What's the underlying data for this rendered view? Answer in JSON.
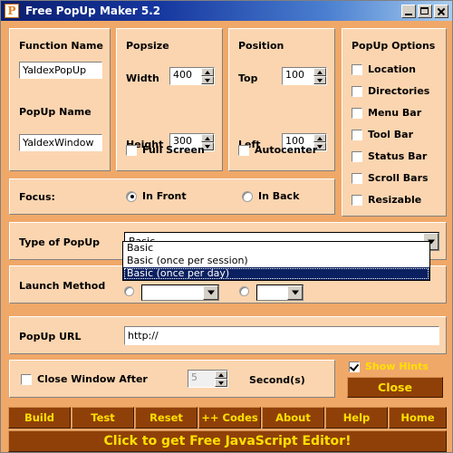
{
  "window": {
    "title": "Free PopUp Maker 5.2",
    "icon": "P",
    "minimize": "minimize-icon",
    "maximize": "maximize-icon",
    "close": "close-icon"
  },
  "function_panel": {
    "function_name_label": "Function Name",
    "function_name_value": "YaldexPopUp",
    "popup_name_label": "PopUp Name",
    "popup_name_value": "YaldexWindow"
  },
  "popsize_panel": {
    "title": "Popsize",
    "width_label": "Width",
    "width_value": "400",
    "height_label": "Height",
    "height_value": "300",
    "fullscreen_label": "Full Screen",
    "fullscreen_checked": false
  },
  "position_panel": {
    "title": "Position",
    "top_label": "Top",
    "top_value": "100",
    "left_label": "Left",
    "left_value": "100",
    "autocenter_label": "Autocenter",
    "autocenter_checked": false
  },
  "options_panel": {
    "title": "PopUp Options",
    "items": [
      {
        "label": "Location",
        "accel": "L",
        "checked": false
      },
      {
        "label": "Directories",
        "accel": "i",
        "checked": false
      },
      {
        "label": "Menu Bar",
        "accel": "M",
        "checked": false
      },
      {
        "label": "Tool Bar",
        "accel": "l",
        "checked": false
      },
      {
        "label": "Status Bar",
        "accel": "B",
        "checked": false
      },
      {
        "label": "Scroll Bars",
        "accel": "c",
        "checked": false
      },
      {
        "label": "Resizable",
        "accel": "R",
        "checked": false
      }
    ]
  },
  "focus_panel": {
    "label": "Focus:",
    "in_front_label": "In Front",
    "in_back_label": "In Back",
    "selected": "In Front"
  },
  "type_panel": {
    "label": "Type of PopUp",
    "selected_value": "Basic",
    "options": [
      "Basic",
      "Basic (once per session)",
      "Basic (once per day)"
    ],
    "highlighted_option": "Basic (once per day)",
    "dropdown_open": true
  },
  "launch_panel": {
    "label": "Launch Method"
  },
  "url_panel": {
    "label": "PopUp URL",
    "value": "http://"
  },
  "close_after_panel": {
    "label": "Close Window After",
    "checked": false,
    "seconds_value": "5",
    "seconds_label": "Second(s)",
    "seconds_enabled": false
  },
  "hints": {
    "label": "Show Hints",
    "checked": true,
    "close_button": "Close"
  },
  "toolbar": {
    "buttons": [
      {
        "label": "Build",
        "accel": "d"
      },
      {
        "label": "Test",
        "accel": "T"
      },
      {
        "label": "Reset",
        "accel": "R"
      },
      {
        "label": "++ Codes",
        "accel": ""
      },
      {
        "label": "About",
        "accel": "A"
      },
      {
        "label": "Help",
        "accel": "H"
      },
      {
        "label": "Home",
        "accel": ""
      }
    ]
  },
  "banner": {
    "text": "Click to get   Free JavaScript Editor!"
  },
  "colors": {
    "panel_fill": "#fbd5b0",
    "window_bg": "#f0a868",
    "button_brown": "#8f4008",
    "button_text": "#ffe000",
    "highlight_navy": "#0a2060"
  }
}
